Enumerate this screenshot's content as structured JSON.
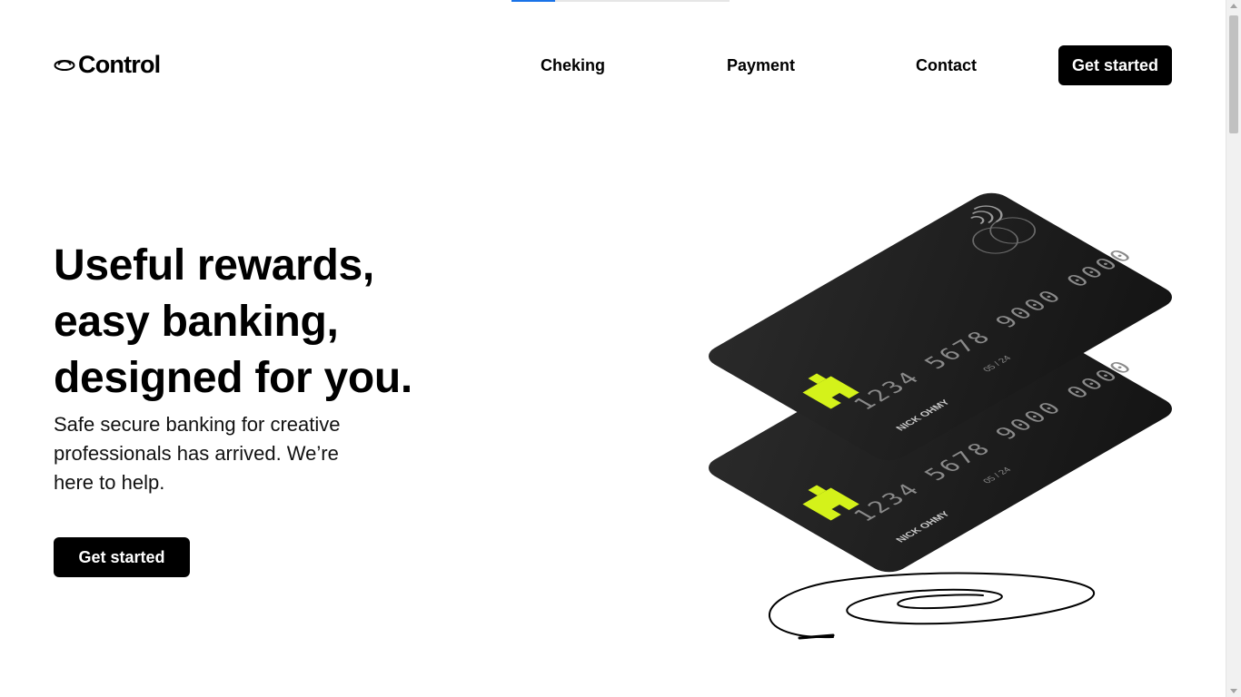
{
  "brand": {
    "name": "Control",
    "icon": "saucer-logo-icon"
  },
  "nav": {
    "items": [
      {
        "label": "Cheking"
      },
      {
        "label": "Payment"
      },
      {
        "label": "Contact"
      }
    ],
    "cta_label": "Get started"
  },
  "hero": {
    "title_lines": [
      "Useful rewards,",
      "easy banking,",
      "designed for you."
    ],
    "subtitle_lines": [
      "Safe secure banking for creative",
      "professionals has arrived. We’re",
      "here to help."
    ],
    "cta_label": "Get started"
  },
  "cards": [
    {
      "number": "1234 5678 9000 0000",
      "holder": "NICK OHMY",
      "expiry": "05 / 24",
      "icons": [
        "contactless-icon",
        "card-network-icon",
        "card-brand-icon"
      ]
    },
    {
      "number": "1234 5678 9000 0000",
      "holder": "NICK OHMY",
      "expiry": "05 / 24",
      "icons": [
        "card-network-icon",
        "card-brand-icon"
      ]
    }
  ],
  "colors": {
    "primary": "#000000",
    "accent": "#d4f21a",
    "card": "#1c1c1c",
    "loading_bar": "#1a73e8"
  },
  "loading_progress": 0.2
}
